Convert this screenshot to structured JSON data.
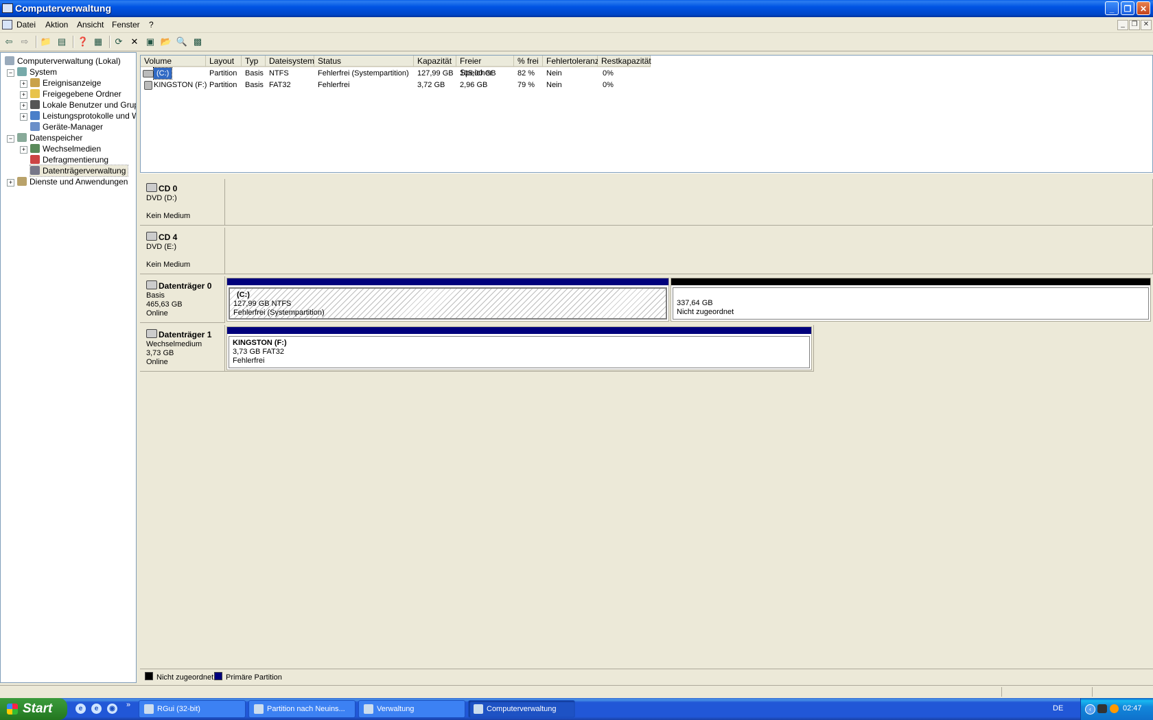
{
  "window": {
    "title": "Computerverwaltung"
  },
  "menus": [
    "Datei",
    "Aktion",
    "Ansicht",
    "Fenster",
    "?"
  ],
  "tree": {
    "root": "Computerverwaltung (Lokal)",
    "system": "System",
    "system_items": [
      "Ereignisanzeige",
      "Freigegebene Ordner",
      "Lokale Benutzer und Gruppen",
      "Leistungsprotokolle und Warnungen",
      "Geräte-Manager"
    ],
    "storage": "Datenspeicher",
    "storage_items": [
      "Wechselmedien",
      "Defragmentierung",
      "Datenträgerverwaltung"
    ],
    "services": "Dienste und Anwendungen"
  },
  "volume_table": {
    "columns": [
      "Volume",
      "Layout",
      "Typ",
      "Dateisystem",
      "Status",
      "Kapazität",
      "Freier Speicher",
      "% frei",
      "Fehlertoleranz",
      "Restkapazität"
    ],
    "rows": [
      [
        "(C:)",
        "Partition",
        "Basis",
        "NTFS",
        "Fehlerfrei (Systempartition)",
        "127,99 GB",
        "105,00 GB",
        "82 %",
        "Nein",
        "0%"
      ],
      [
        "KINGSTON (F:)",
        "Partition",
        "Basis",
        "FAT32",
        "Fehlerfrei",
        "3,72 GB",
        "2,96 GB",
        "79 %",
        "Nein",
        "0%"
      ]
    ]
  },
  "disks": [
    {
      "name": "CD 0",
      "line1": "DVD (D:)",
      "line2": "",
      "line3": "Kein Medium"
    },
    {
      "name": "CD 4",
      "line1": "DVD (E:)",
      "line2": "",
      "line3": "Kein Medium"
    },
    {
      "name": "Datenträger 0",
      "line1": "Basis",
      "line2": "465,63 GB",
      "line3": "Online",
      "partitions": [
        {
          "title": "(C:)",
          "size": "127,99 GB NTFS",
          "status": "Fehlerfrei (Systempartition)"
        },
        {
          "title": "",
          "size": "337,64 GB",
          "status": "Nicht zugeordnet"
        }
      ]
    },
    {
      "name": "Datenträger 1",
      "line1": "Wechselmedium",
      "line2": "3,73 GB",
      "line3": "Online",
      "partitions": [
        {
          "title": "KINGSTON  (F:)",
          "size": "3,73 GB FAT32",
          "status": "Fehlerfrei"
        }
      ]
    }
  ],
  "legend": [
    "Nicht zugeordnet",
    "Primäre Partition"
  ],
  "colors": {
    "unallocated": "#000000",
    "primary": "#00007c",
    "selection": "#316ac5"
  },
  "taskbar": {
    "start": "Start",
    "tasks": [
      "RGui (32-bit)",
      "Partition nach Neuins...",
      "Verwaltung",
      "Computerverwaltung"
    ],
    "language": "DE",
    "clock": "02:47"
  }
}
